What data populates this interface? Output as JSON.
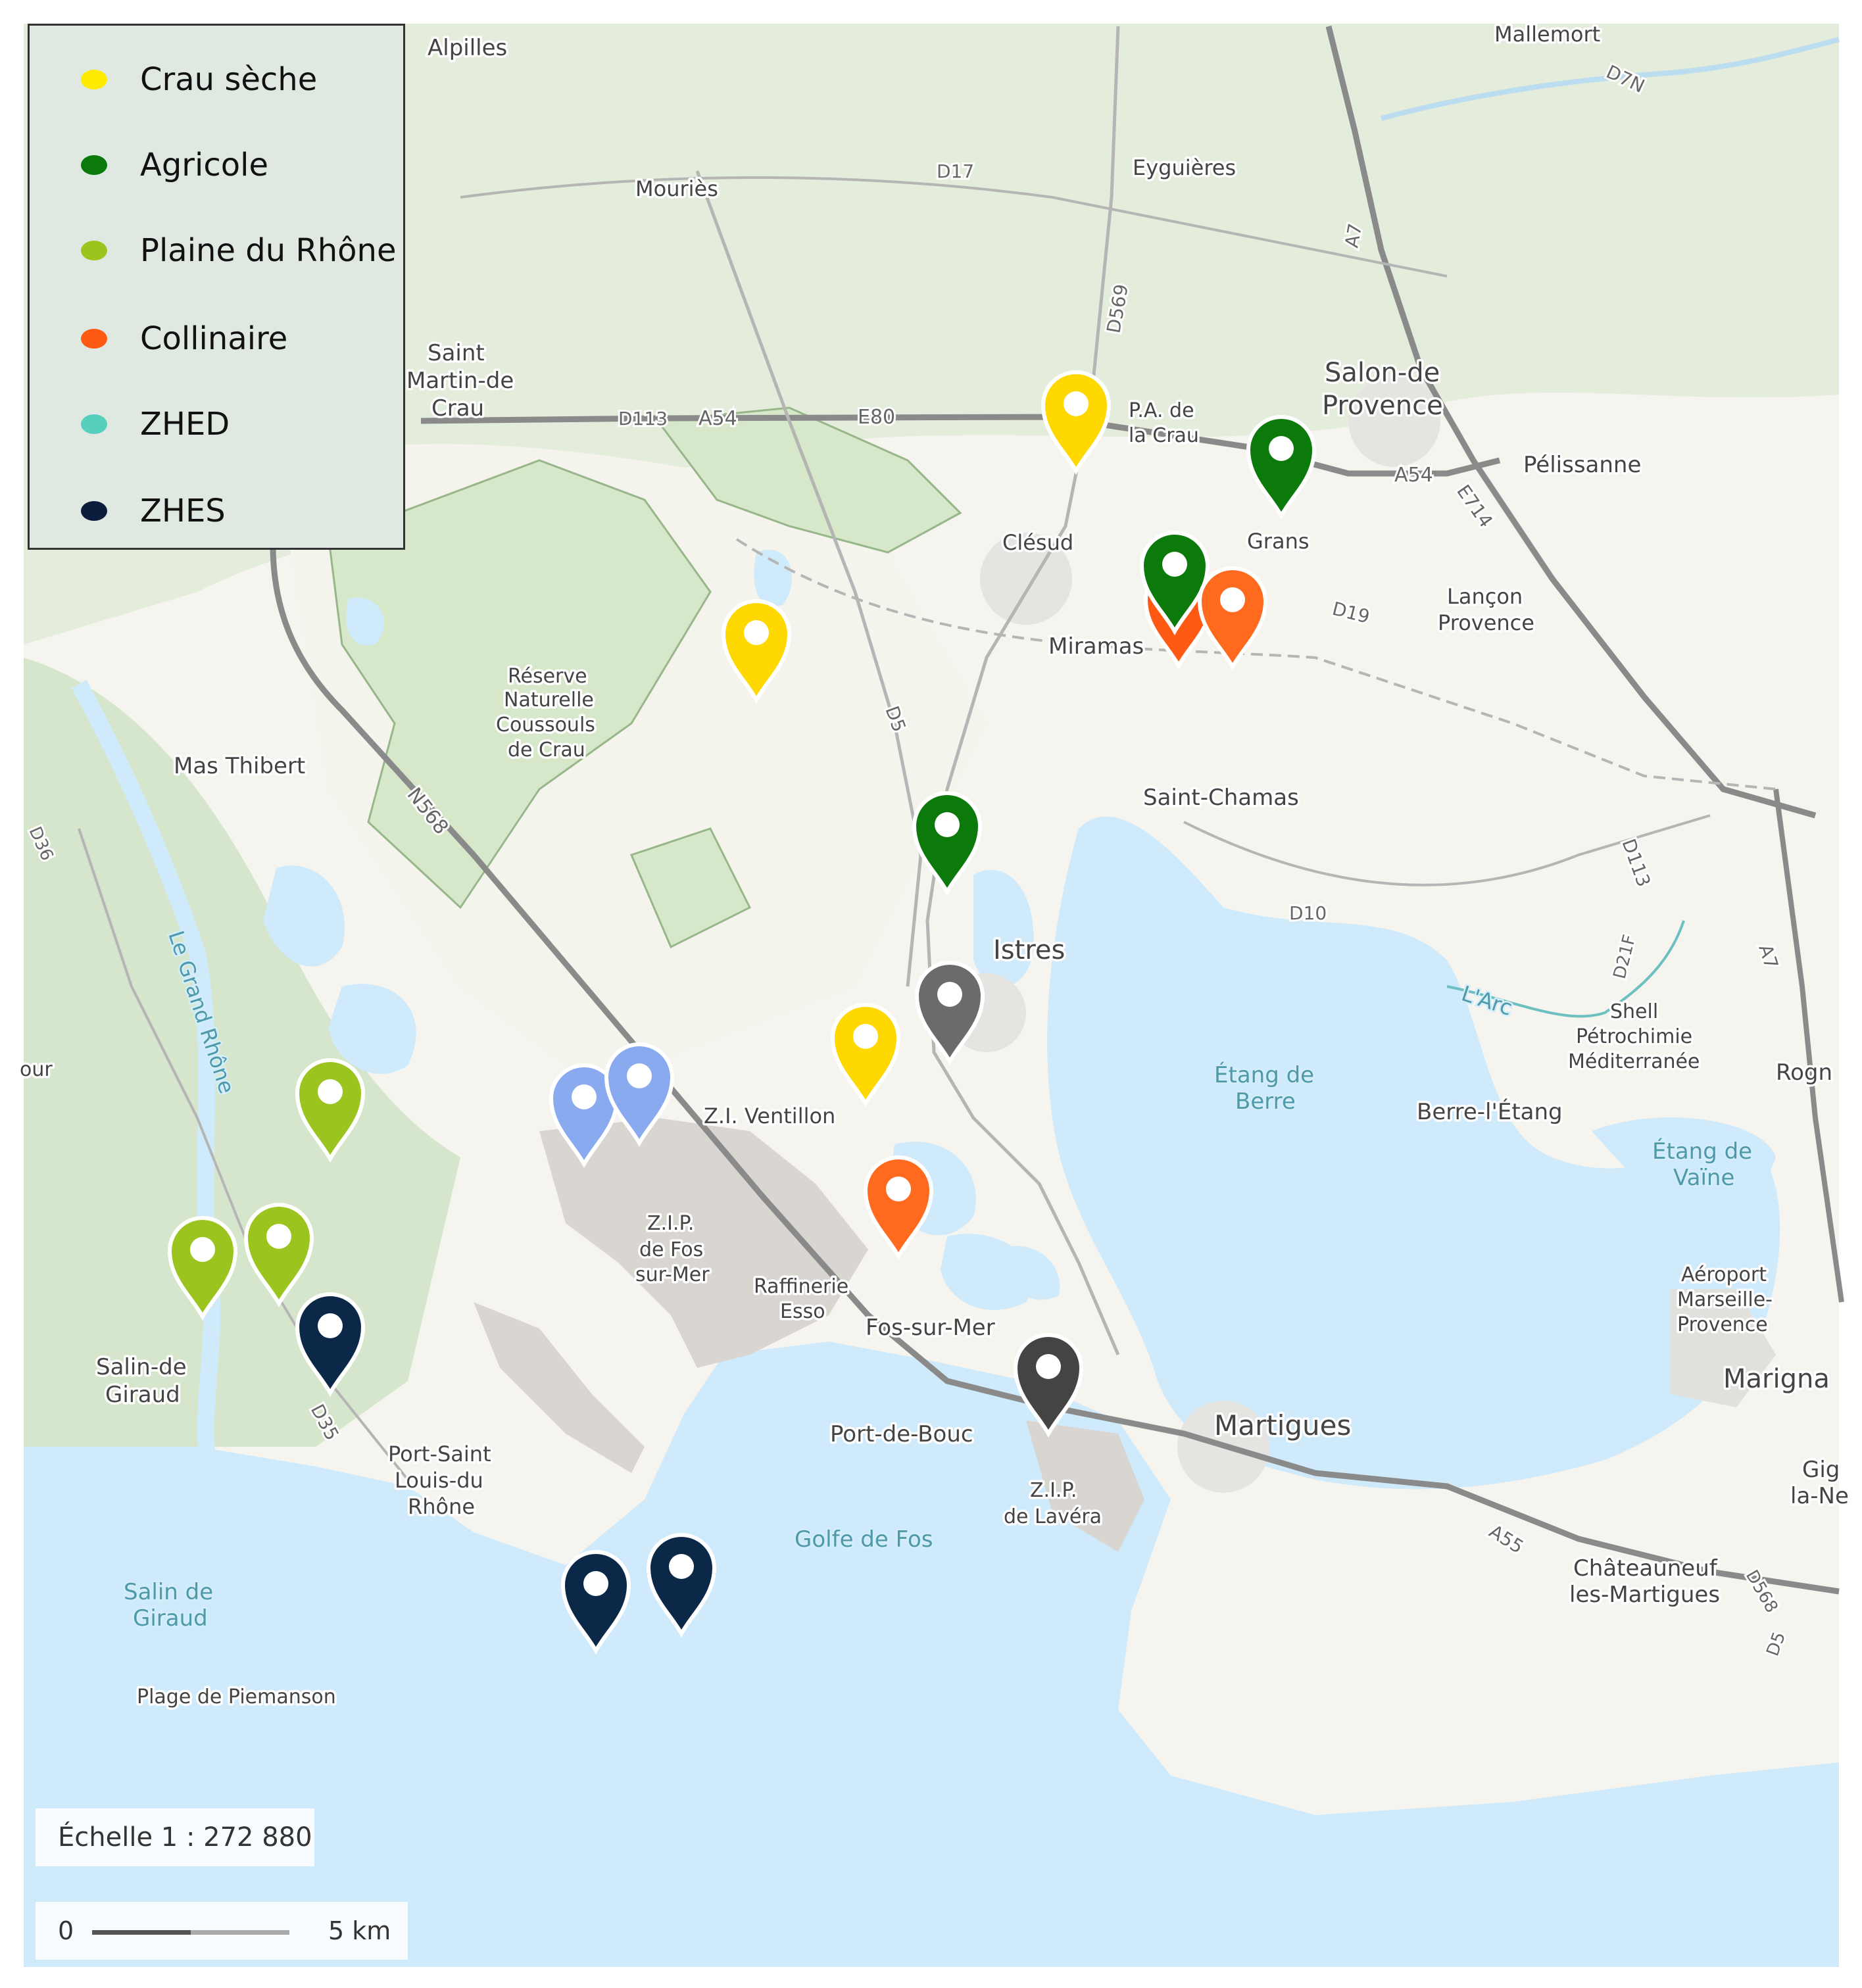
{
  "legend": {
    "items": [
      {
        "label": "Crau sèche",
        "color": "#ffea00"
      },
      {
        "label": "Agricole",
        "color": "#0b7a0b"
      },
      {
        "label": "Plaine du Rhône",
        "color": "#9bc41f"
      },
      {
        "label": "Collinaire",
        "color": "#ff5a14"
      },
      {
        "label": "ZHED",
        "color": "#56d0bc"
      },
      {
        "label": "ZHES",
        "color": "#0c1c3c"
      }
    ]
  },
  "scale": {
    "text": "Échelle 1 : 272 880",
    "zero": "0",
    "distance": "5 km"
  },
  "places": {
    "alpilles": "Alpilles",
    "mallemort": "Mallemort",
    "mouries": "Mouriès",
    "eyguieres": "Eyguières",
    "saint_martin_1": "Saint",
    "saint_martin_2": "Martin-de",
    "saint_martin_3": "Crau",
    "salon_1": "Salon-de",
    "salon_2": "Provence",
    "pa_crau_1": "P.A. de",
    "pa_crau_2": "la Crau",
    "pelissanne": "Pélissanne",
    "grans": "Grans",
    "clesud": "Clésud",
    "lancon_1": "Lançon",
    "lancon_2": "Provence",
    "miramas": "Miramas",
    "reserve_1": "Réserve",
    "reserve_2": "Naturelle",
    "reserve_3": "Coussouls",
    "reserve_4": "de Crau",
    "mas_thibert": "Mas Thibert",
    "saint_chamas": "Saint-Chamas",
    "istres": "Istres",
    "shell_1": "Shell",
    "shell_2": "Pétrochimie",
    "shell_3": "Méditerranée",
    "rogn": "Rogn",
    "berre_letang": "Berre-l'Étang",
    "zi_ventillon": "Z.I. Ventillon",
    "zip_fos_1": "Z.I.P.",
    "zip_fos_2": "de Fos",
    "zip_fos_3": "sur-Mer",
    "raffinerie_1": "Raffinerie",
    "raffinerie_2": "Esso",
    "fos": "Fos-sur-Mer",
    "aeroport_1": "Aéroport",
    "aeroport_2": "Marseille-",
    "aeroport_3": "Provence",
    "marigna": "Marigna",
    "salin_giraud_1": "Salin-de",
    "salin_giraud_2": "Giraud",
    "port_bouc": "Port-de-Bouc",
    "martigues": "Martigues",
    "port_st_louis_1": "Port-Saint",
    "port_st_louis_2": "Louis-du",
    "port_st_louis_3": "Rhône",
    "zip_lavera_1": "Z.I.P.",
    "zip_lavera_2": "de Lavéra",
    "gig_1": "Gig",
    "gig_2": "la-Ne",
    "chateauneuf_1": "Châteauneuf",
    "chateauneuf_2": "les-Martigues",
    "plage_piemanson": "Plage de Piemanson",
    "our": "our"
  },
  "water": {
    "etang_berre_1": "Étang de",
    "etang_berre_2": "Berre",
    "etang_vaine_1": "Étang de",
    "etang_vaine_2": "Vaïne",
    "golfe_fos": "Golfe de Fos",
    "salin_giraud_1": "Salin de",
    "salin_giraud_2": "Giraud",
    "larc": "L'Arc",
    "grand_rhone": "Le Grand Rhône"
  },
  "roads": {
    "d17": "D17",
    "d113": "D113",
    "a54_w": "A54",
    "e80": "E80",
    "a54_e": "A54",
    "e714": "E714",
    "d7n": "D7N",
    "a7_n": "A7",
    "d569": "D569",
    "d19": "D19",
    "d5": "D5",
    "n568": "N568",
    "d36": "D36",
    "d10": "D10",
    "d113_e": "D113",
    "d21f": "D21F",
    "a7_s": "A7",
    "d35": "D35",
    "a55": "A55",
    "d568": "D568",
    "d5_s": "D5"
  },
  "markers": [
    {
      "category": "Crau sèche",
      "color": "#ffd800"
    },
    {
      "category": "Agricole",
      "color": "#0b7a0b"
    },
    {
      "category": "Crau sèche",
      "color": "#ffd800"
    },
    {
      "category": "Collinaire",
      "color": "#ff5a14"
    },
    {
      "category": "Agricole",
      "color": "#0b7a0b"
    },
    {
      "category": "Collinaire",
      "color": "#ff6a1e"
    },
    {
      "category": "Agricole",
      "color": "#0b7a0b"
    },
    {
      "category": "Unlisted (grey)",
      "color": "#6b6b6b"
    },
    {
      "category": "Crau sèche",
      "color": "#ffd800"
    },
    {
      "category": "Unlisted (light blue)",
      "color": "#8aaaf0"
    },
    {
      "category": "Unlisted (light blue)",
      "color": "#8aaaf0"
    },
    {
      "category": "Collinaire",
      "color": "#ff6a1e"
    },
    {
      "category": "Plaine du Rhône",
      "color": "#9bc41f"
    },
    {
      "category": "Plaine du Rhône",
      "color": "#9bc41f"
    },
    {
      "category": "Plaine du Rhône",
      "color": "#9bc41f"
    },
    {
      "category": "ZHES",
      "color": "#0c2848"
    },
    {
      "category": "Unlisted (dark grey)",
      "color": "#444444"
    },
    {
      "category": "ZHES",
      "color": "#0c2848"
    },
    {
      "category": "ZHES",
      "color": "#0c2848"
    }
  ]
}
